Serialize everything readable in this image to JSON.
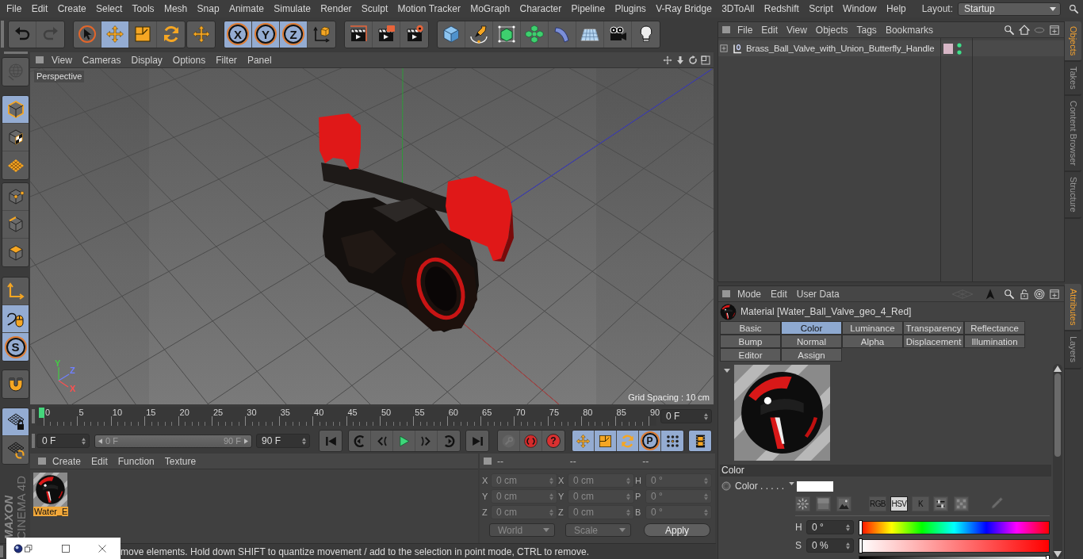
{
  "menu_bar": {
    "items": [
      "File",
      "Edit",
      "Create",
      "Select",
      "Tools",
      "Mesh",
      "Snap",
      "Animate",
      "Simulate",
      "Render",
      "Sculpt",
      "Motion Tracker",
      "MoGraph",
      "Character",
      "Pipeline",
      "Plugins",
      "V-Ray Bridge",
      "3DToAll",
      "Redshift",
      "Script",
      "Window",
      "Help"
    ],
    "layout_label": "Layout:",
    "layout_value": "Startup"
  },
  "toolbar": {
    "groups": [
      [
        {
          "kind": "undo",
          "selected": false,
          "disabled": false
        },
        {
          "kind": "redo",
          "selected": false,
          "disabled": true
        }
      ],
      [
        {
          "kind": "select",
          "selected": false,
          "disabled": false
        },
        {
          "kind": "move",
          "selected": true,
          "disabled": false
        },
        {
          "kind": "scale",
          "selected": false,
          "disabled": false
        },
        {
          "kind": "rotate",
          "selected": false,
          "disabled": false
        }
      ],
      [
        {
          "kind": "recent",
          "selected": false,
          "disabled": false
        }
      ],
      [
        {
          "kind": "axis",
          "label": "X",
          "selected": true,
          "disabled": false
        },
        {
          "kind": "axis",
          "label": "Y",
          "selected": true,
          "disabled": false
        },
        {
          "kind": "axis",
          "label": "Z",
          "selected": true,
          "disabled": false
        },
        {
          "kind": "coord",
          "selected": false,
          "disabled": false
        }
      ],
      [
        {
          "kind": "render_view",
          "selected": false,
          "disabled": false
        },
        {
          "kind": "render_pv",
          "selected": false,
          "disabled": false
        },
        {
          "kind": "render_settings",
          "selected": false,
          "disabled": false
        }
      ],
      [
        {
          "kind": "cube",
          "selected": false,
          "disabled": false
        },
        {
          "kind": "pen",
          "selected": false,
          "disabled": false
        },
        {
          "kind": "subdiv",
          "selected": false,
          "disabled": false
        },
        {
          "kind": "cloner",
          "selected": false,
          "disabled": false
        },
        {
          "kind": "deformer",
          "selected": false,
          "disabled": false
        },
        {
          "kind": "floor",
          "selected": false,
          "disabled": false
        },
        {
          "kind": "camera",
          "selected": false,
          "disabled": false
        },
        {
          "kind": "light",
          "selected": false,
          "disabled": false
        }
      ]
    ]
  },
  "mode_bar": {
    "groups": [
      [
        {
          "kind": "globe",
          "selected": false,
          "disabled": true
        }
      ],
      [
        {
          "kind": "model",
          "selected": true,
          "disabled": false
        },
        {
          "kind": "texture",
          "selected": false,
          "disabled": false
        },
        {
          "kind": "workplane",
          "selected": false,
          "disabled": false
        }
      ],
      [
        {
          "kind": "points",
          "selected": false,
          "disabled": false
        },
        {
          "kind": "edges",
          "selected": false,
          "disabled": false
        },
        {
          "kind": "polygons",
          "selected": false,
          "disabled": false
        }
      ],
      [
        {
          "kind": "axis_mode",
          "selected": false,
          "disabled": false
        },
        {
          "kind": "tweak",
          "selected": true,
          "disabled": false
        },
        {
          "kind": "solo",
          "label": "S",
          "selected": true,
          "disabled": false
        }
      ],
      [
        {
          "kind": "magnet",
          "selected": false,
          "disabled": false
        }
      ],
      [
        {
          "kind": "grid_lock",
          "selected": true,
          "disabled": false
        },
        {
          "kind": "grid_sync",
          "selected": false,
          "disabled": false
        }
      ]
    ]
  },
  "logo": [
    "MAXON",
    "CINEMA 4D"
  ],
  "viewport": {
    "menu": [
      "View",
      "Cameras",
      "Display",
      "Options",
      "Filter",
      "Panel"
    ],
    "camera": "Perspective",
    "axis_labels": [
      {
        "label": "Y",
        "color": "#44cc44"
      },
      {
        "label": "Z",
        "color": "#7080ff"
      },
      {
        "label": "X",
        "color": "#ff5050"
      }
    ],
    "grid_spacing": "Grid Spacing : 10 cm"
  },
  "timeline": {
    "ticks": [
      "0",
      "5",
      "10",
      "15",
      "20",
      "25",
      "30",
      "35",
      "40",
      "45",
      "50",
      "55",
      "60",
      "65",
      "70",
      "75",
      "80",
      "85",
      "90"
    ],
    "playhead": {
      "level": 0
    },
    "current_frame": "0 F"
  },
  "playback": {
    "start": "0 F",
    "range": {
      "start": "0 F",
      "end": "90 F",
      "level": 1
    },
    "end": "90 F",
    "groups": [
      [
        {
          "kind": "go_start",
          "selected": false,
          "disabled": false
        }
      ],
      [
        {
          "kind": "prev_key",
          "selected": false,
          "disabled": false
        },
        {
          "kind": "prev_frame",
          "selected": false,
          "disabled": false
        },
        {
          "kind": "play",
          "selected": false,
          "disabled": false
        },
        {
          "kind": "next_frame",
          "selected": false,
          "disabled": false
        },
        {
          "kind": "next_key",
          "selected": false,
          "disabled": false
        }
      ],
      [
        {
          "kind": "go_end",
          "selected": false,
          "disabled": false
        }
      ],
      [
        {
          "kind": "key",
          "selected": false,
          "disabled": true
        },
        {
          "kind": "record",
          "selected": false,
          "disabled": false
        },
        {
          "kind": "key_select",
          "label": "?",
          "selected": false,
          "disabled": false
        }
      ],
      [
        {
          "kind": "key_position",
          "selected": true,
          "disabled": false
        },
        {
          "kind": "key_scale",
          "selected": true,
          "disabled": false
        },
        {
          "kind": "key_rotation",
          "selected": true,
          "disabled": false
        },
        {
          "kind": "param_key",
          "label": "P",
          "selected": true,
          "disabled": false
        },
        {
          "kind": "pla",
          "selected": true,
          "disabled": false
        }
      ],
      [
        {
          "kind": "timeline",
          "selected": true,
          "disabled": false
        }
      ]
    ]
  },
  "material_manager": {
    "menu": [
      "Create",
      "Edit",
      "Function",
      "Texture"
    ],
    "materials": [
      {
        "name": "Water_E",
        "selected": true
      }
    ]
  },
  "coordinates": {
    "headers": [
      "--",
      "--",
      "--"
    ],
    "disabled": true,
    "rows": [
      [
        {
          "axis": "X",
          "value": "0 cm"
        },
        {
          "axis": "X",
          "value": "0 cm"
        },
        {
          "axis": "H",
          "value": "0 °"
        }
      ],
      [
        {
          "axis": "Y",
          "value": "0 cm"
        },
        {
          "axis": "Y",
          "value": "0 cm"
        },
        {
          "axis": "P",
          "value": "0 °"
        }
      ],
      [
        {
          "axis": "Z",
          "value": "0 cm"
        },
        {
          "axis": "Z",
          "value": "0 cm"
        },
        {
          "axis": "B",
          "value": "0 °"
        }
      ]
    ],
    "dropdowns": [
      "World",
      "Scale"
    ],
    "apply": "Apply"
  },
  "status_bar": {
    "message": "move elements. Hold down SHIFT to quantize movement / add to the selection in point mode, CTRL to remove."
  },
  "objects_manager": {
    "menu": [
      "File",
      "Edit",
      "View",
      "Objects",
      "Tags",
      "Bookmarks"
    ],
    "objects": [
      {
        "name": "Brass_Ball_Valve_with_Union_Butterfly_Handle",
        "expanded": false,
        "color": "#d7b6c6"
      }
    ]
  },
  "side_tabs": {
    "top": [
      {
        "label": "Objects",
        "selected": true
      },
      {
        "label": "Takes",
        "selected": false
      },
      {
        "label": "Content Browser",
        "selected": false
      },
      {
        "label": "Structure",
        "selected": false
      }
    ],
    "bottom": [
      {
        "label": "Attributes",
        "selected": true
      },
      {
        "label": "Layers",
        "selected": false
      }
    ]
  },
  "attributes_manager": {
    "menu": [
      "Mode",
      "Edit",
      "User Data"
    ],
    "title": "Material [Water_Ball_Valve_geo_4_Red]",
    "tabs": [
      {
        "label": "Basic",
        "selected": false
      },
      {
        "label": "Color",
        "selected": true
      },
      {
        "label": "Luminance",
        "selected": false
      },
      {
        "label": "Transparency",
        "selected": false
      },
      {
        "label": "Reflectance",
        "selected": false
      },
      {
        "label": "Bump",
        "selected": false
      },
      {
        "label": "Normal",
        "selected": false
      },
      {
        "label": "Alpha",
        "selected": false
      },
      {
        "label": "Displacement",
        "selected": false
      },
      {
        "label": "Illumination",
        "selected": false
      },
      {
        "label": "Editor",
        "selected": false
      },
      {
        "label": "Assign",
        "selected": false
      }
    ],
    "section": "Color",
    "color_field": {
      "label": "Color . . . . .",
      "color": "#ffffff"
    },
    "color_modes": [
      {
        "kind": "wheel",
        "selected": false
      },
      {
        "kind": "spectrum",
        "selected": false
      },
      {
        "kind": "picture",
        "selected": false
      },
      {
        "kind": "text",
        "label": "RGB",
        "selected": false
      },
      {
        "kind": "text",
        "label": "HSV",
        "selected": true
      },
      {
        "kind": "text",
        "label": "K",
        "selected": false
      },
      {
        "kind": "mixer",
        "selected": false
      },
      {
        "kind": "swatches",
        "selected": false
      }
    ],
    "sliders": [
      {
        "kind": "hue",
        "label": "H",
        "value": "0 °",
        "level": 0
      },
      {
        "kind": "saturation",
        "label": "S",
        "value": "0 %",
        "level": 0
      },
      {
        "kind": "brightness",
        "level": 1
      }
    ]
  }
}
